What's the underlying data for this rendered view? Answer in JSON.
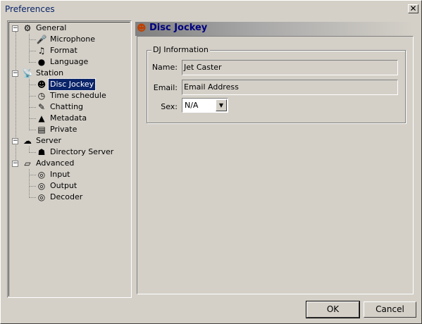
{
  "window": {
    "title": "Preferences",
    "close_symbol": "✕"
  },
  "tree": {
    "general": {
      "label": "General",
      "children": [
        "Microphone",
        "Format",
        "Language"
      ]
    },
    "station": {
      "label": "Station",
      "children": [
        "Disc Jockey",
        "Time schedule",
        "Chatting",
        "Metadata",
        "Private"
      ]
    },
    "server": {
      "label": "Server",
      "children": [
        "Directory Server"
      ]
    },
    "advanced": {
      "label": "Advanced",
      "children": [
        "Input",
        "Output",
        "Decoder"
      ]
    },
    "selected": "Disc Jockey"
  },
  "panel": {
    "title": "Disc Jockey",
    "group_title": "DJ Information",
    "name_label": "Name:",
    "name_value": "Jet Caster",
    "email_label": "Email:",
    "email_value": "Email Address",
    "sex_label": "Sex:",
    "sex_value": "N/A"
  },
  "buttons": {
    "ok": "OK",
    "cancel": "Cancel"
  },
  "icons": {
    "general": "gear-icon",
    "microphone": "microphone-icon",
    "format": "music-note-icon",
    "language": "globe-icon",
    "station": "satellite-icon",
    "disc_jockey": "dj-icon",
    "time_schedule": "clock-icon",
    "chatting": "chat-icon",
    "metadata": "metadata-icon",
    "private": "private-icon",
    "server": "server-icon",
    "directory_server": "directory-icon",
    "advanced": "notebook-icon",
    "input": "input-icon",
    "output": "output-icon",
    "decoder": "decoder-icon"
  }
}
